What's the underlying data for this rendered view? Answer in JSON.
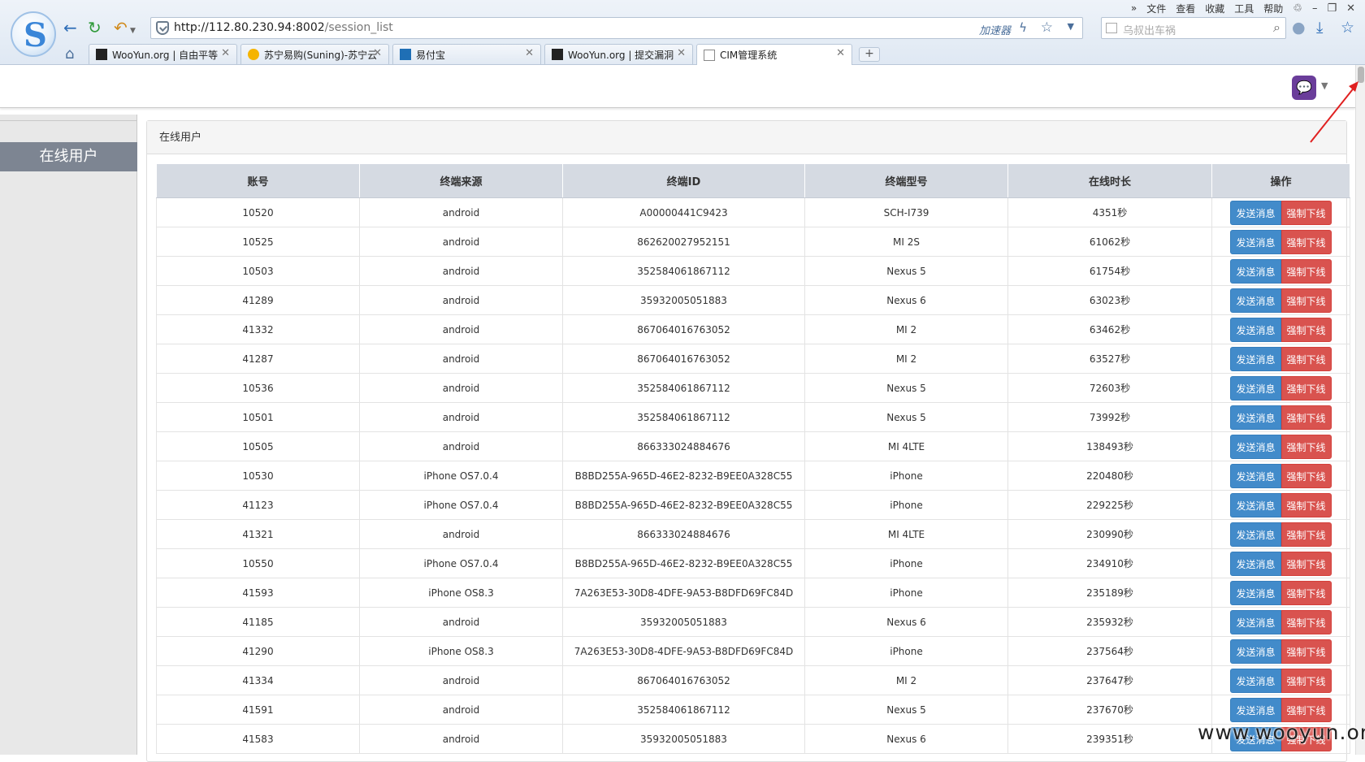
{
  "browser": {
    "menu": [
      "文件",
      "查看",
      "收藏",
      "工具",
      "帮助"
    ],
    "menu_chevron": "»",
    "url_host": "http://112.80.230.94:8002",
    "url_path": "/session_list",
    "accelerator_label": "加速器",
    "search_placeholder": "乌叔出车祸",
    "tabs": [
      {
        "title": "WooYun.org | 自由平等",
        "icon": "wooyun-icon"
      },
      {
        "title": "苏宁易购(Suning)-苏宁云",
        "icon": "suning-icon"
      },
      {
        "title": "易付宝",
        "icon": "yifubao-icon"
      },
      {
        "title": "WooYun.org | 提交漏洞",
        "icon": "wooyun-icon"
      },
      {
        "title": "CIM管理系统",
        "icon": "page-icon"
      }
    ],
    "new_tab_label": "+"
  },
  "sidebar": {
    "items": [
      {
        "label": "在线用户"
      }
    ]
  },
  "panel": {
    "title": "在线用户"
  },
  "table": {
    "headers": [
      "账号",
      "终端来源",
      "终端ID",
      "终端型号",
      "在线时长",
      "操作"
    ],
    "send_label": "发送消息",
    "kick_label": "强制下线",
    "rows": [
      [
        "10520",
        "android",
        "A00000441C9423",
        "SCH-I739",
        "4351秒"
      ],
      [
        "10525",
        "android",
        "862620027952151",
        "MI 2S",
        "61062秒"
      ],
      [
        "10503",
        "android",
        "352584061867112",
        "Nexus 5",
        "61754秒"
      ],
      [
        "41289",
        "android",
        "35932005051883",
        "Nexus 6",
        "63023秒"
      ],
      [
        "41332",
        "android",
        "867064016763052",
        "MI 2",
        "63462秒"
      ],
      [
        "41287",
        "android",
        "867064016763052",
        "MI 2",
        "63527秒"
      ],
      [
        "10536",
        "android",
        "352584061867112",
        "Nexus 5",
        "72603秒"
      ],
      [
        "10501",
        "android",
        "352584061867112",
        "Nexus 5",
        "73992秒"
      ],
      [
        "10505",
        "android",
        "866333024884676",
        "MI 4LTE",
        "138493秒"
      ],
      [
        "10530",
        "iPhone OS7.0.4",
        "B8BD255A-965D-46E2-8232-B9EE0A328C55",
        "iPhone",
        "220480秒"
      ],
      [
        "41123",
        "iPhone OS7.0.4",
        "B8BD255A-965D-46E2-8232-B9EE0A328C55",
        "iPhone",
        "229225秒"
      ],
      [
        "41321",
        "android",
        "866333024884676",
        "MI 4LTE",
        "230990秒"
      ],
      [
        "10550",
        "iPhone OS7.0.4",
        "B8BD255A-965D-46E2-8232-B9EE0A328C55",
        "iPhone",
        "234910秒"
      ],
      [
        "41593",
        "iPhone OS8.3",
        "7A263E53-30D8-4DFE-9A53-B8DFD69FC84D",
        "iPhone",
        "235189秒"
      ],
      [
        "41185",
        "android",
        "35932005051883",
        "Nexus 6",
        "235932秒"
      ],
      [
        "41290",
        "iPhone OS8.3",
        "7A263E53-30D8-4DFE-9A53-B8DFD69FC84D",
        "iPhone",
        "237564秒"
      ],
      [
        "41334",
        "android",
        "867064016763052",
        "MI 2",
        "237647秒"
      ],
      [
        "41591",
        "android",
        "352584061867112",
        "Nexus 5",
        "237670秒"
      ],
      [
        "41583",
        "android",
        "35932005051883",
        "Nexus 6",
        "239351秒"
      ]
    ]
  },
  "watermark": "www.wooyun.org",
  "colors": {
    "send_button": "#428bca",
    "kick_button": "#d9534f",
    "sidebar_active": "#7d8592",
    "annotation_arrow": "#e02020"
  }
}
